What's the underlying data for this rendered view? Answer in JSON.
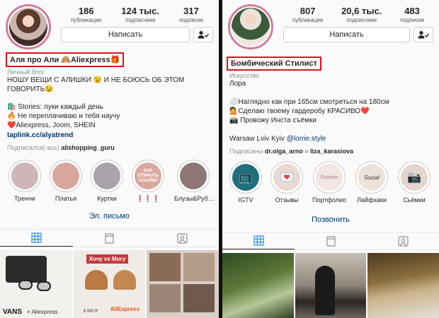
{
  "left": {
    "stats": [
      {
        "num": "186",
        "label": "публикации"
      },
      {
        "num": "124 тыс.",
        "label": "подписчики"
      },
      {
        "num": "317",
        "label": "подписки"
      }
    ],
    "message_button": "Написать",
    "name": "Аля про Али 🙈Aliexpress🎁",
    "category": "Личный блог",
    "bio_line1": "НОШУ ВЕЩИ С АЛИШКИ 😉 И НЕ БОЮСЬ ОБ ЭТОМ",
    "bio_line2": "ГОВОРИТЬ😉",
    "bio_line3": "🛍️ Stories: луки каждый день",
    "bio_line4": "🔥 Не переплачиваю и тебя научу",
    "bio_line5": "❤️Aliexpress, Joom, SHEIN",
    "bio_link": "taplink.cc/alyatrend",
    "followed_prefix": "Подписался(-ась)",
    "followed_user": "alishopping_guru",
    "highlights": [
      {
        "label": "Тренчи",
        "color": "#cdb5b8",
        "inner_text": ""
      },
      {
        "label": "Платья",
        "color": "#d7a79c",
        "inner_text": ""
      },
      {
        "label": "Куртки",
        "color": "#a8a3a8",
        "inner_text": ""
      },
      {
        "label": "❗❗❗",
        "color": "#dba8a0",
        "inner_text": "КАК ОТКРЫТЬ ССЫЛКИ"
      },
      {
        "label": "Блузы&Руб…",
        "color": "#8e7676",
        "inner_text": ""
      }
    ],
    "action": "Эл. письмо",
    "grid": {
      "label_vans": "VANS",
      "label_x_ali": "× Aliexpress",
      "label_hochu": "Хочу vs Могу",
      "label_aliexpress": "AliExpress",
      "label_price": "9 000 Р"
    }
  },
  "right": {
    "stats": [
      {
        "num": "807",
        "label": "публикации"
      },
      {
        "num": "20,6 тыс.",
        "label": "подписчики"
      },
      {
        "num": "483",
        "label": "подписки"
      }
    ],
    "message_button": "Написать",
    "name": "Бомбический Стилист",
    "category": "Искусство",
    "bio_name": "Лора",
    "bio_line1": "⚪Наглядно как при 165см смотреться на 180см",
    "bio_line2": "💁Сделаю твоему гардеробу КРАСИВО❤️",
    "bio_line3": "📸 Провожу Инста съёмки",
    "bio_location": "Warsaw Lviv Kyiv",
    "bio_mention": "@lorrie.style",
    "followed_prefix": "Подписаны",
    "followed_user1": "dr.olga_arno",
    "followed_and": "и",
    "followed_user2": "liza_karasiova",
    "highlights": [
      {
        "label": "IGTV",
        "color": "#1f6f7c",
        "inner_text": "📺"
      },
      {
        "label": "Отзывы",
        "color": "#ead9d0",
        "inner_text": "💌"
      },
      {
        "label": "Портфолио",
        "color": "#f1e6e3",
        "inner_text": "Fashion"
      },
      {
        "label": "Лайфхаки",
        "color": "#ece2da",
        "inner_text": "Social"
      },
      {
        "label": "Сьёмки",
        "color": "#e4d6cd",
        "inner_text": "📷"
      }
    ],
    "action": "Позвонить"
  }
}
